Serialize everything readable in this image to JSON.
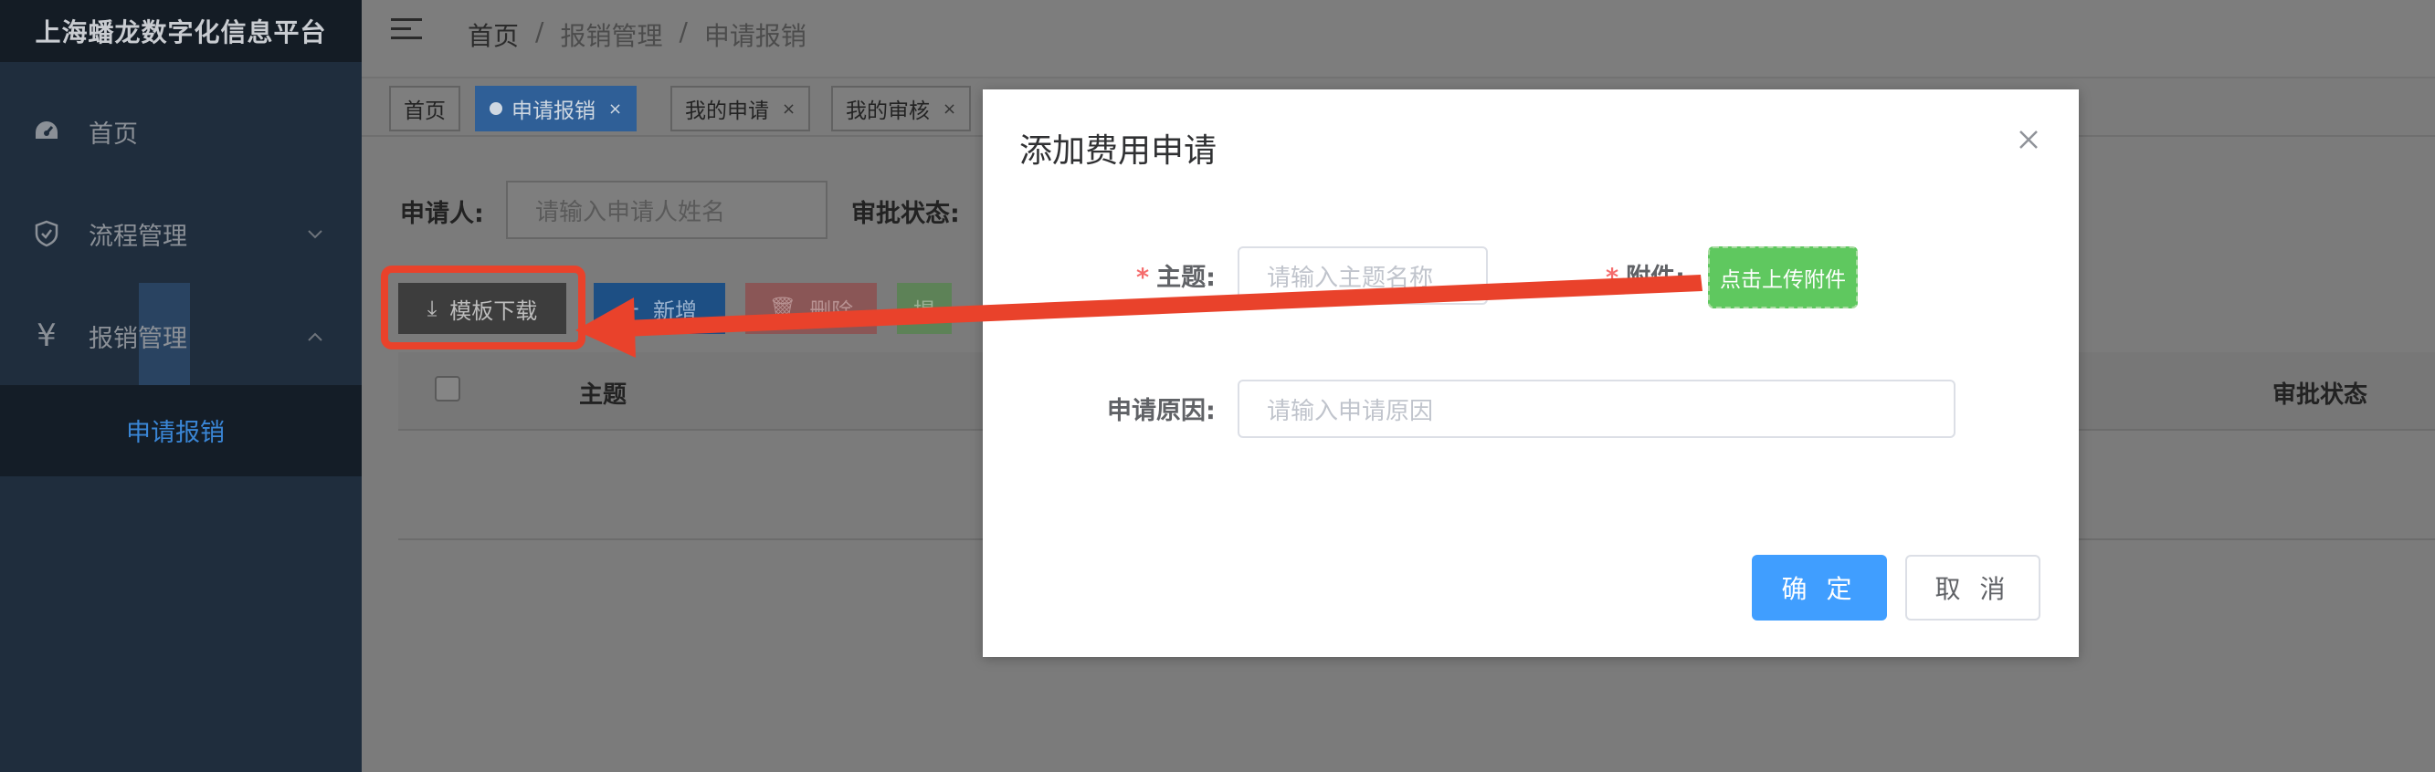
{
  "sidebar": {
    "logo": "上海蟠龙数字化信息平台",
    "items": [
      {
        "label": "首页",
        "icon": "dashboard-icon"
      },
      {
        "label": "流程管理",
        "icon": "shield-icon"
      },
      {
        "label": "报销管理",
        "icon": "yen-icon"
      }
    ],
    "submenu_item": "申请报销"
  },
  "navbar": {
    "breadcrumb": [
      "首页",
      "报销管理",
      "申请报销"
    ]
  },
  "tags": [
    {
      "label": "首页"
    },
    {
      "label": "申请报销"
    },
    {
      "label": "我的申请"
    },
    {
      "label": "我的审核"
    }
  ],
  "search": {
    "applicant_label": "申请人:",
    "applicant_placeholder": "请输入申请人姓名",
    "status_label": "审批状态:"
  },
  "toolbar": {
    "template_download": "模板下载",
    "add": "新增",
    "delete": "删除",
    "extra": "提"
  },
  "table": {
    "headers": [
      "主题",
      "审批状态"
    ]
  },
  "modal": {
    "title": "添加费用申请",
    "subject_label": "主题:",
    "subject_placeholder": "请输入主题名称",
    "attachment_label": "附件:",
    "upload_button": "点击上传附件",
    "reason_label": "申请原因:",
    "reason_placeholder": "请输入申请原因",
    "confirm": "确 定",
    "cancel": "取 消"
  },
  "colors": {
    "primary": "#409eff",
    "upload_green": "#5fc85f",
    "annotation_red": "#e9422b",
    "required": "#f56c6c"
  }
}
